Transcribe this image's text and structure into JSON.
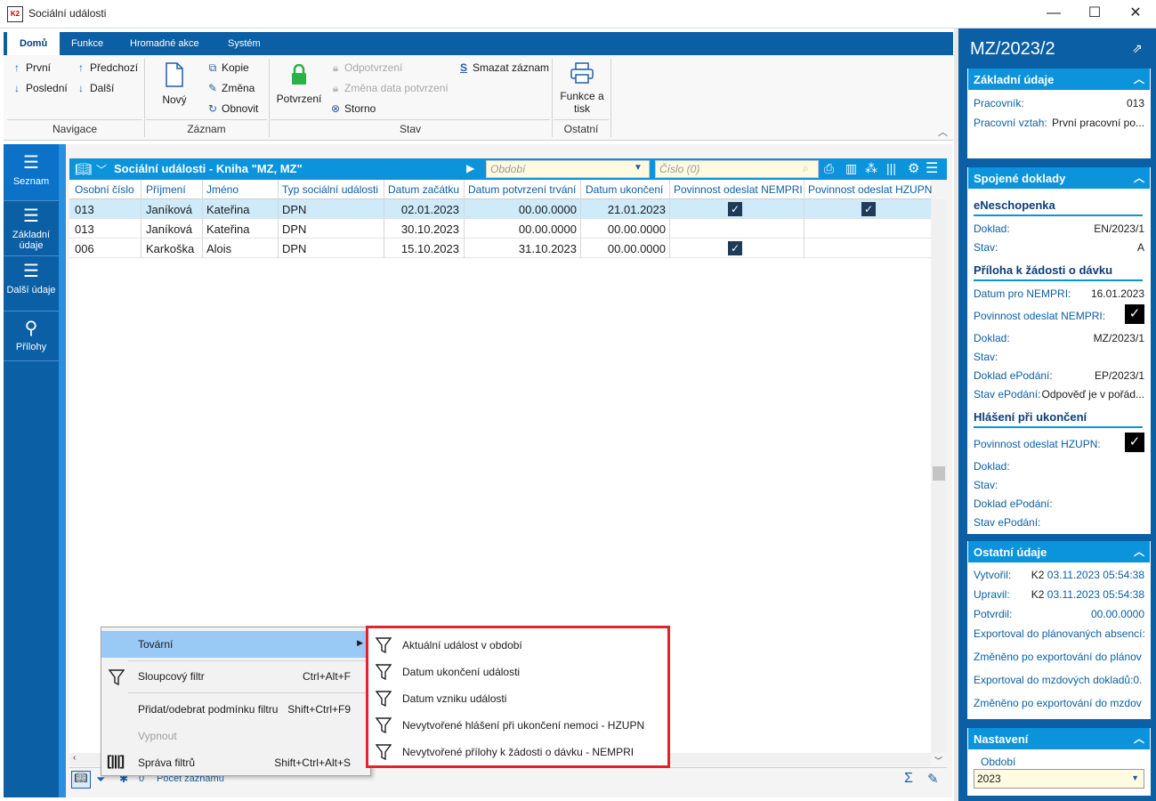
{
  "window": {
    "title": "Sociální události",
    "logo": "K2",
    "min": "—",
    "max": "☐",
    "close": "✕"
  },
  "ribbon": {
    "tabs": [
      "Domů",
      "Funkce",
      "Hromadné akce",
      "Systém"
    ],
    "nav": {
      "first": "První",
      "last": "Poslední",
      "prev": "Předchozí",
      "next": "Další",
      "label": "Navigace"
    },
    "record": {
      "new": "Nový",
      "copy": "Kopie",
      "change": "Změna",
      "refresh": "Obnovit",
      "label": "Záznam"
    },
    "state": {
      "confirm": "Potvrzení",
      "unconfirm": "Odpotvrzení",
      "change_date": "Změna data potvrzení",
      "storno": "Storno",
      "delete": "Smazat záznam",
      "label": "Stav"
    },
    "other": {
      "print": "Funkce a tisk",
      "label": "Ostatní"
    }
  },
  "leftnav": [
    "Seznam",
    "Základní údaje",
    "Další údaje",
    "Přílohy"
  ],
  "grid": {
    "title": "Sociální události - Kniha \"MZ, MZ\"",
    "period_placeholder": "Období",
    "number_placeholder": "Číslo (0)",
    "columns": [
      "Osobní číslo",
      "Příjmení",
      "Jméno",
      "Typ sociální události",
      "Datum začátku",
      "Datum potvrzení trvání",
      "Datum ukončení",
      "Povinnost odeslat NEMPRI",
      "Povinnost odeslat HZUPN"
    ],
    "rows": [
      {
        "id": "013",
        "surname": "Janíková",
        "name": "Kateřina",
        "type": "DPN",
        "start": "02.01.2023",
        "confirm": "00.00.0000",
        "end": "21.01.2023",
        "nempri": true,
        "hzupn": true
      },
      {
        "id": "013",
        "surname": "Janíková",
        "name": "Kateřina",
        "type": "DPN",
        "start": "30.10.2023",
        "confirm": "00.00.0000",
        "end": "00.00.0000",
        "nempri": false,
        "hzupn": false
      },
      {
        "id": "006",
        "surname": "Karkoška",
        "name": "Alois",
        "type": "DPN",
        "start": "15.10.2023",
        "confirm": "31.10.2023",
        "end": "00.00.0000",
        "nempri": true,
        "hzupn": false
      }
    ],
    "status": {
      "filter_count": "0",
      "record_count": "Počet záznamů"
    }
  },
  "context_menu": {
    "items": [
      {
        "label": "Tovární",
        "shortcut": ""
      },
      {
        "label": "Sloupcový filtr",
        "shortcut": "Ctrl+Alt+F"
      },
      {
        "label": "Přidat/odebrat podmínku filtru",
        "shortcut": "Shift+Ctrl+F9"
      },
      {
        "label": "Vypnout",
        "shortcut": ""
      },
      {
        "label": "Správa filtrů",
        "shortcut": "Shift+Ctrl+Alt+S"
      }
    ],
    "submenu": [
      "Aktuální událost v období",
      "Datum ukončení události",
      "Datum vzniku události",
      "Nevytvořené hlášení při ukončení nemoci - HZUPN",
      "Nevytvořené přílohy k žádosti o dávku - NEMPRI"
    ]
  },
  "right_panel": {
    "title": "MZ/2023/2",
    "basic": {
      "head": "Základní údaje",
      "worker_label": "Pracovník:",
      "worker": "013",
      "relation_label": "Pracovní vztah:",
      "relation": "První pracovní po..."
    },
    "linked": {
      "head": "Spojené doklady",
      "eneschopenka": "eNeschopenka",
      "en_doc_label": "Doklad:",
      "en_doc": "EN/2023/1",
      "en_state_label": "Stav:",
      "en_state": "A",
      "priloha": "Příloha k žádosti o dávku",
      "date_label": "Datum pro NEMPRI:",
      "date": "16.01.2023",
      "nempri_label": "Povinnost odeslat NEMPRI:",
      "p_doc_label": "Doklad:",
      "p_doc": "MZ/2023/1",
      "p_state_label": "Stav:",
      "p_epodani_label": "Doklad ePodání:",
      "p_epodani": "EP/2023/1",
      "p_stav_ep_label": "Stav ePodání:",
      "p_stav_ep": "Odpověď je v pořád...",
      "hlaseni": "Hlášení při ukončení",
      "hzupn_label": "Povinnost odeslat HZUPN:",
      "h_doc_label": "Doklad:",
      "h_state_label": "Stav:",
      "h_epodani_label": "Doklad ePodání:",
      "h_stav_ep_label": "Stav ePodání:"
    },
    "other": {
      "head": "Ostatní údaje",
      "created_label": "Vytvořil:",
      "created_by": "K2",
      "created": "03.11.2023 05:54:38",
      "updated_label": "Upravil:",
      "updated_by": "K2",
      "updated": "03.11.2023 05:54:38",
      "confirmed_label": "Potvrdil:",
      "confirmed": "00.00.0000",
      "l1": "Exportoval do plánovaných absencí:",
      "l2": "Změněno po exportování do plánov",
      "l3": "Exportoval do mzdových dokladů:0.",
      "l4": "Změněno po exportování do mzdov"
    },
    "settings": {
      "head": "Nastavení",
      "period_label": "Období",
      "period": "2023"
    }
  }
}
